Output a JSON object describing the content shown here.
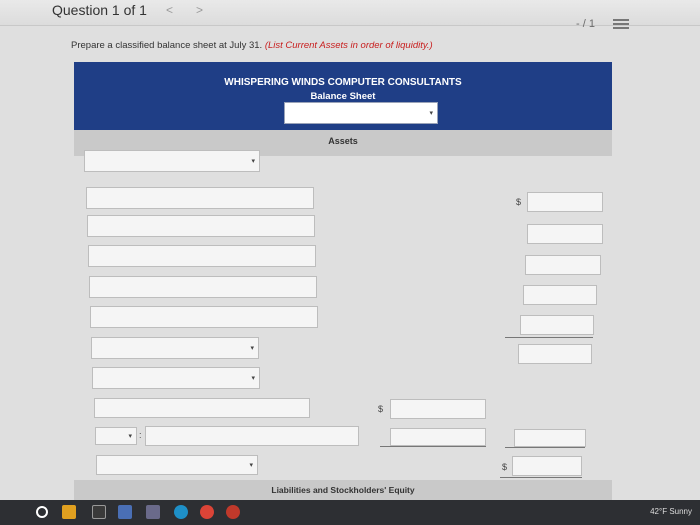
{
  "header": {
    "title": "Question 1 of 1",
    "prev": "<",
    "next": ">",
    "score": "- / 1"
  },
  "instructions": {
    "text": "Prepare a classified balance sheet at July 31.",
    "hint": "(List Current Assets in order of liquidity.)"
  },
  "statement": {
    "company": "WHISPERING WINDS COMPUTER CONSULTANTS",
    "title": "Balance Sheet",
    "date_value": ""
  },
  "sections": {
    "assets": "Assets",
    "liabilities": "Liabilities and Stockholders' Equity"
  },
  "symbols": {
    "dollar": "$",
    "caret": "▾",
    "colon": ":"
  },
  "taskbar": {
    "weather": "42°F Sunny"
  },
  "colors": {
    "header_band": "#1f3e86",
    "section_band": "#c9c9c9",
    "hint_red": "#c81e1e",
    "taskbar": "#2d2f33"
  }
}
